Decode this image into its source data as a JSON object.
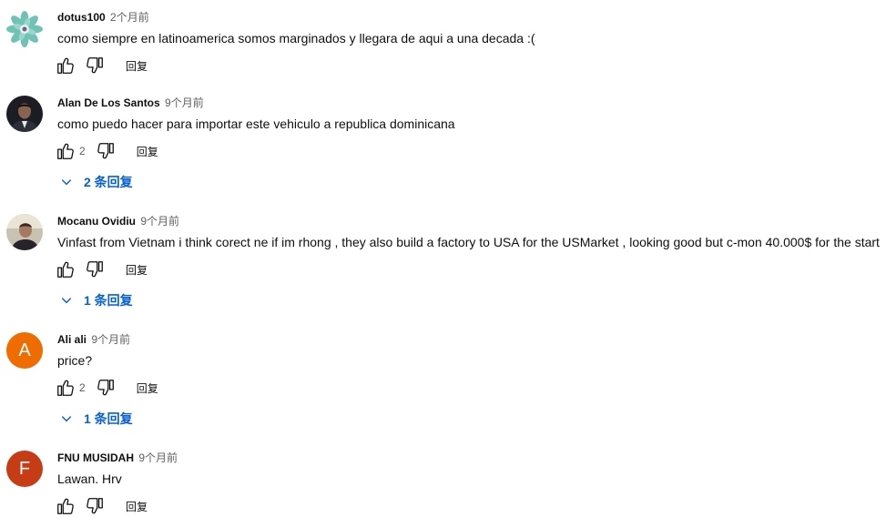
{
  "labels": {
    "reply": "回复"
  },
  "comments": [
    {
      "author": "dotus100",
      "time": "2个月前",
      "text": "como siempre en latinoamerica somos marginados y llegara de aqui a una decada :(",
      "likes": "",
      "replies": ""
    },
    {
      "author": "Alan De Los Santos",
      "time": "9个月前",
      "text": "como puedo hacer para importar este vehiculo a republica dominicana",
      "likes": "2",
      "replies": "2 条回复"
    },
    {
      "author": "Mocanu Ovidiu",
      "time": "9个月前",
      "text": "Vinfast from Vietnam i think corect ne if im rhong , they also build a factory to USA for the USMarket , looking good but c-mon 40.000$ for the start",
      "likes": "",
      "replies": "1 条回复"
    },
    {
      "author": "Ali ali",
      "time": "9个月前",
      "text": "price?",
      "likes": "2",
      "replies": "1 条回复",
      "avatar_letter": "A",
      "avatar_color": "#ef6c00"
    },
    {
      "author": "FNU MUSIDAH",
      "time": "9个月前",
      "text": "Lawan. Hrv",
      "likes": "",
      "replies": "",
      "avatar_letter": "F",
      "avatar_color": "#c63c15"
    }
  ],
  "colors": {
    "link_blue": "#065fd4",
    "secondary_text": "#606060"
  }
}
